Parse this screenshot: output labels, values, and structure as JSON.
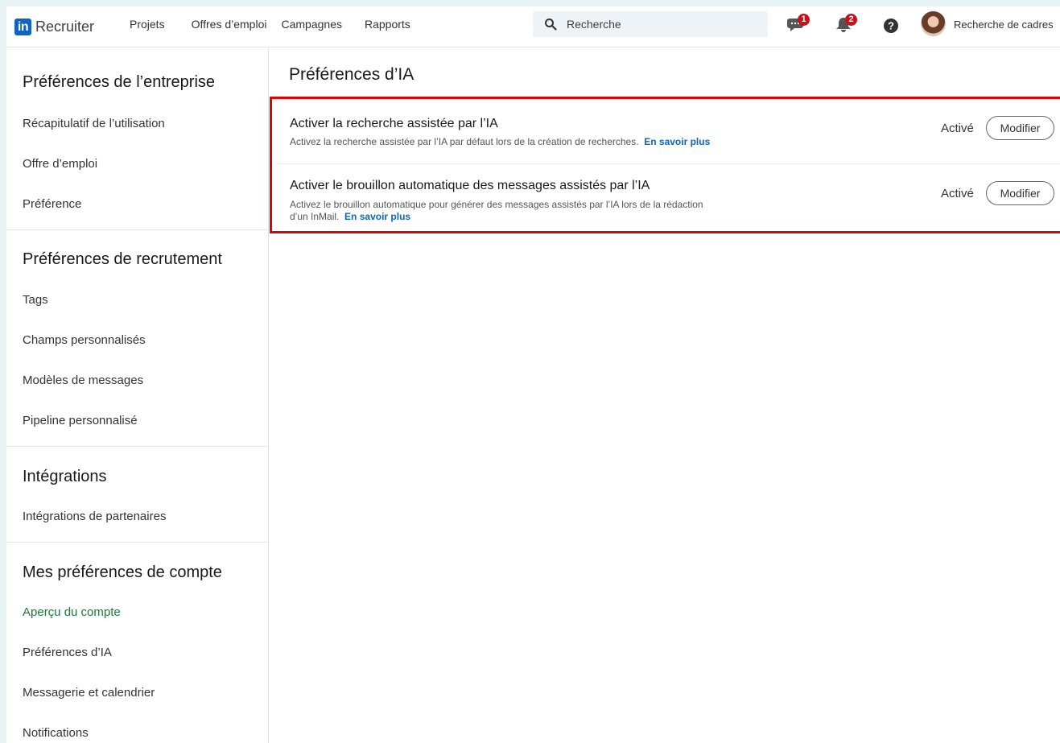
{
  "nav": {
    "logo_text": "Recruiter",
    "links": [
      "Projets",
      "Offres d’emploi",
      "Campagnes",
      "Rapports"
    ],
    "search_placeholder": "Recherche",
    "messages_badge": "1",
    "notifications_badge": "2",
    "account_label": "Recherche de cadres",
    "brand_color": "#0a66c2",
    "badge_color": "#cc1016"
  },
  "sidebar": {
    "sections": [
      {
        "title": "Préférences de l’entreprise",
        "items": [
          "Récapitulatif de l’utilisation",
          "Offre d’emploi",
          "Préférence"
        ]
      },
      {
        "title": "Préférences de recrutement",
        "items": [
          "Tags",
          "Champs personnalisés",
          "Modèles de messages",
          "Pipeline personnalisé"
        ]
      },
      {
        "title": "Intégrations",
        "items": [
          "Intégrations de partenaires"
        ]
      },
      {
        "title": "Mes préférences de compte",
        "items": [
          "Aperçu du compte",
          "Préférences d’IA",
          "Messagerie et calendrier",
          "Notifications"
        ]
      }
    ],
    "active_item": "Aperçu du compte",
    "active_color": "#1a7a3a"
  },
  "main": {
    "title": "Préférences d’IA",
    "rows": [
      {
        "title": "Activer la recherche assistée par l’IA",
        "description": "Activez la recherche assistée par l’IA par défaut lors de la création de recherches.",
        "description_line2": "",
        "learn_more": "En savoir plus",
        "status": "Activé",
        "button": "Modifier"
      },
      {
        "title": "Activer le brouillon automatique des messages assistés par l’IA",
        "description": "Activez le brouillon automatique pour générer des messages assistés par l’IA lors de la rédaction",
        "description_line2": "d’un InMail.",
        "learn_more": "En savoir plus",
        "status": "Activé",
        "button": "Modifier"
      }
    ],
    "highlight_color": "#e00000"
  }
}
